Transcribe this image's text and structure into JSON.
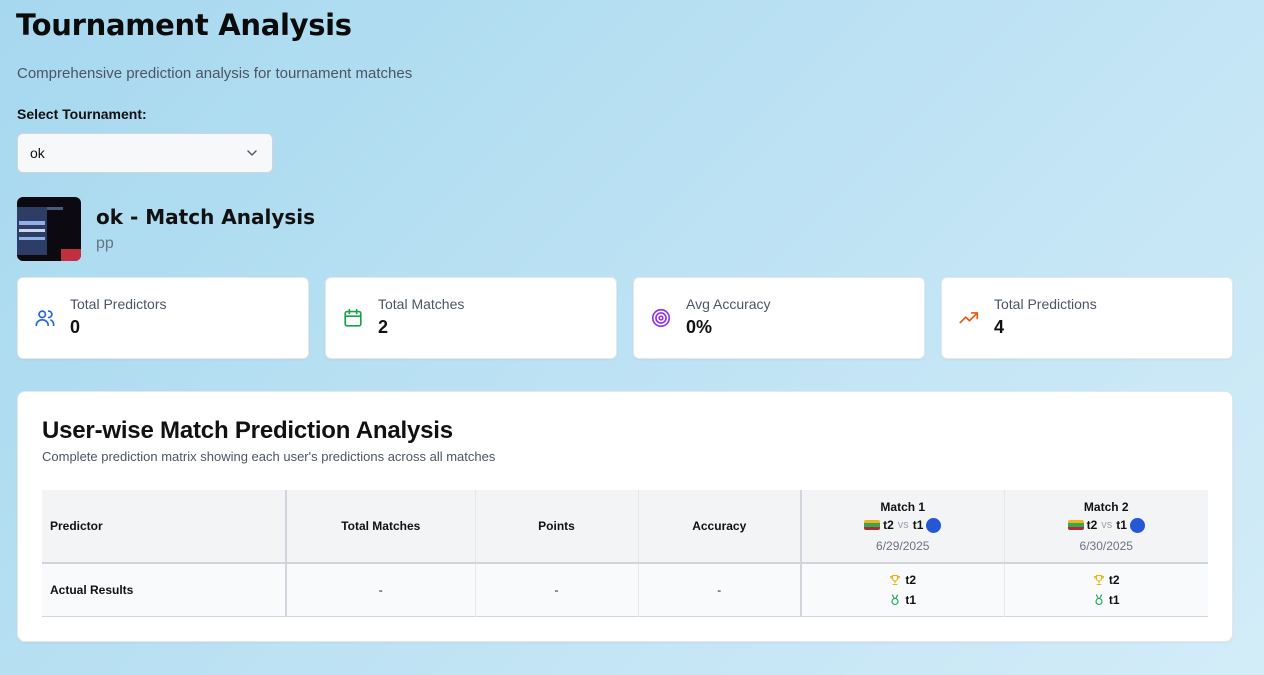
{
  "header": {
    "title": "Tournament Analysis",
    "subtitle": "Comprehensive prediction analysis for tournament matches"
  },
  "tournament_select": {
    "label": "Select Tournament:",
    "value": "ok",
    "icon": "chevron-down-icon"
  },
  "tournament": {
    "name": "ok - Match Analysis",
    "description": "pp"
  },
  "stats": [
    {
      "label": "Total Predictors",
      "value": "0",
      "icon": "users-icon",
      "color": "#2563eb"
    },
    {
      "label": "Total Matches",
      "value": "2",
      "icon": "calendar-icon",
      "color": "#16a34a"
    },
    {
      "label": "Avg Accuracy",
      "value": "0%",
      "icon": "target-icon",
      "color": "#9333ea"
    },
    {
      "label": "Total Predictions",
      "value": "4",
      "icon": "trending-up-icon",
      "color": "#ea580c"
    }
  ],
  "matrix": {
    "title": "User-wise Match Prediction Analysis",
    "subtitle": "Complete prediction matrix showing each user's predictions across all matches",
    "columns": {
      "predictor": "Predictor",
      "total_matches": "Total Matches",
      "points": "Points",
      "accuracy": "Accuracy"
    },
    "matches": [
      {
        "title": "Match 1",
        "team1": "t2",
        "vs": "vs",
        "team2": "t1",
        "date": "6/29/2025"
      },
      {
        "title": "Match 2",
        "team1": "t2",
        "vs": "vs",
        "team2": "t1",
        "date": "6/30/2025"
      }
    ],
    "rows": [
      {
        "predictor": "Actual Results",
        "total_matches": "-",
        "points": "-",
        "accuracy": "-",
        "results": [
          {
            "winner": "t2",
            "loser": "t1"
          },
          {
            "winner": "t2",
            "loser": "t1"
          }
        ]
      }
    ]
  }
}
